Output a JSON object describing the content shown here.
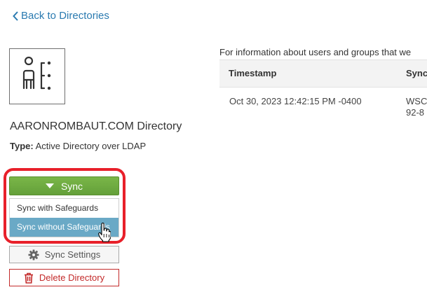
{
  "nav": {
    "back_label": "Back to Directories"
  },
  "directory": {
    "icon": "directory-person-icon",
    "name": "AARONROMBAUT.COM Directory",
    "type_label": "Type:",
    "type_value": "Active Directory over LDAP"
  },
  "actions": {
    "sync_label": "Sync",
    "sync_menu": [
      "Sync with Safeguards",
      "Sync without Safeguards"
    ],
    "sync_menu_highlighted_index": 1,
    "settings_label": "Sync Settings",
    "delete_label": "Delete Directory"
  },
  "info": {
    "text": "For information about users and groups that we"
  },
  "table": {
    "headers": [
      "Timestamp",
      "Sync"
    ],
    "rows": [
      {
        "timestamp": "Oct 30, 2023 12:42:15 PM -0400",
        "sync_line1": "WSC",
        "sync_line2": "92-8"
      }
    ]
  },
  "colors": {
    "link": "#2a7ab0",
    "sync_green": "#6aa83e",
    "highlight_red": "#e8202a",
    "menu_hover": "#6aa9c6",
    "delete_red": "#c32a2a"
  }
}
